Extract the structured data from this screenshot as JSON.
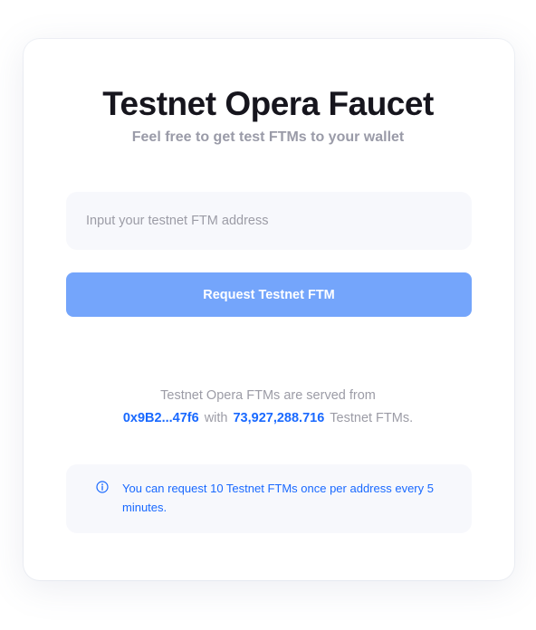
{
  "header": {
    "title": "Testnet Opera Faucet",
    "subtitle": "Feel free to get test FTMs to your wallet"
  },
  "form": {
    "address_placeholder": "Input your testnet FTM address",
    "address_value": "",
    "submit_label": "Request Testnet FTM"
  },
  "source": {
    "line1": "Testnet Opera FTMs are served from",
    "address": "0x9B2...47f6",
    "with_word": "with",
    "balance": "73,927,288.716",
    "suffix": "Testnet FTMs."
  },
  "notice": {
    "icon": "info-icon",
    "text": "You can request 10 Testnet FTMs once per address every 5 minutes."
  },
  "colors": {
    "accent": "#1969ff",
    "button": "#74a5fb",
    "title": "#16151d",
    "muted": "#9c9ca6",
    "field_bg": "#f7f8fc"
  }
}
